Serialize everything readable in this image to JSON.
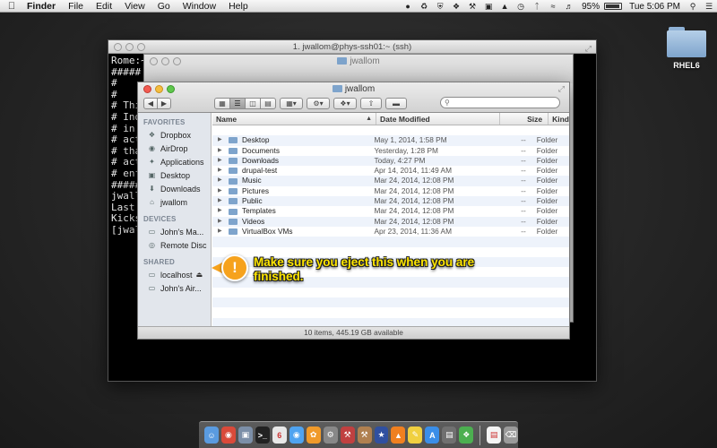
{
  "menubar": {
    "app": "Finder",
    "menus": [
      "File",
      "Edit",
      "View",
      "Go",
      "Window",
      "Help"
    ],
    "battery_percent": "95%",
    "battery_level": 0.95,
    "clock": "Tue 5:06 PM"
  },
  "desktop": {
    "icon_label": "RHEL6"
  },
  "terminal": {
    "title": "1. jwallom@phys-ssh01:~ (ssh)",
    "lines": [
      "Rome:~                                                                edu",
      "#####",
      "#",
      "#",
      "# This",
      "# Indi",
      "# in c",
      "# acti",
      "# that",
      "# acti",
      "# enfo",
      "######",
      "jwallo",
      "Last l",
      "Kickst",
      "[jwall"
    ]
  },
  "finder_back": {
    "title": "jwallom"
  },
  "finder": {
    "title": "jwallom",
    "search_placeholder": "",
    "sidebar": {
      "favorites_header": "FAVORITES",
      "favorites": [
        {
          "label": "Dropbox",
          "icon": "dropbox-icon"
        },
        {
          "label": "AirDrop",
          "icon": "airdrop-icon"
        },
        {
          "label": "Applications",
          "icon": "applications-icon"
        },
        {
          "label": "Desktop",
          "icon": "desktop-icon"
        },
        {
          "label": "Downloads",
          "icon": "downloads-icon"
        },
        {
          "label": "jwallom",
          "icon": "home-icon"
        }
      ],
      "devices_header": "DEVICES",
      "devices": [
        {
          "label": "John's Ma...",
          "icon": "laptop-icon"
        },
        {
          "label": "Remote Disc",
          "icon": "disc-icon"
        }
      ],
      "shared_header": "SHARED",
      "shared": [
        {
          "label": "localhost",
          "icon": "server-icon",
          "eject": true
        },
        {
          "label": "John's Air...",
          "icon": "laptop-icon"
        }
      ]
    },
    "columns": {
      "name": "Name",
      "date": "Date Modified",
      "size": "Size",
      "kind": "Kind"
    },
    "rows": [
      {
        "name": "Desktop",
        "date": "May 1, 2014, 1:58 PM",
        "size": "--",
        "kind": "Folder"
      },
      {
        "name": "Documents",
        "date": "Yesterday, 1:28 PM",
        "size": "--",
        "kind": "Folder"
      },
      {
        "name": "Downloads",
        "date": "Today, 4:27 PM",
        "size": "--",
        "kind": "Folder"
      },
      {
        "name": "drupal-test",
        "date": "Apr 14, 2014, 11:49 AM",
        "size": "--",
        "kind": "Folder"
      },
      {
        "name": "Music",
        "date": "Mar 24, 2014, 12:08 PM",
        "size": "--",
        "kind": "Folder"
      },
      {
        "name": "Pictures",
        "date": "Mar 24, 2014, 12:08 PM",
        "size": "--",
        "kind": "Folder"
      },
      {
        "name": "Public",
        "date": "Mar 24, 2014, 12:08 PM",
        "size": "--",
        "kind": "Folder"
      },
      {
        "name": "Templates",
        "date": "Mar 24, 2014, 12:08 PM",
        "size": "--",
        "kind": "Folder"
      },
      {
        "name": "Videos",
        "date": "Mar 24, 2014, 12:08 PM",
        "size": "--",
        "kind": "Folder"
      },
      {
        "name": "VirtualBox VMs",
        "date": "Apr 23, 2014, 11:36 AM",
        "size": "--",
        "kind": "Folder"
      }
    ],
    "status": "10 items, 445.19 GB available"
  },
  "callout": {
    "marker": "!",
    "text": "Make sure you eject this when you are finished.",
    "color": "#f6a21d",
    "text_color": "#ffe600"
  },
  "dock": {
    "items": [
      {
        "icon": "finder-icon",
        "color": "#5a9be0"
      },
      {
        "icon": "chrome-icon",
        "color": "#d94a3a"
      },
      {
        "icon": "preview-icon",
        "color": "#7c8fa8"
      },
      {
        "icon": "terminal-icon",
        "color": "#222222"
      },
      {
        "icon": "calendar-icon",
        "color": "#e8e8e8"
      },
      {
        "icon": "messages-icon",
        "color": "#4fa3f0"
      },
      {
        "icon": "growl-icon",
        "color": "#f09a2a"
      },
      {
        "icon": "system-preferences-icon",
        "color": "#888888"
      },
      {
        "icon": "utility-icon",
        "color": "#c04040"
      },
      {
        "icon": "tool-icon",
        "color": "#b08050"
      },
      {
        "icon": "app-icon",
        "color": "#3050a0"
      },
      {
        "icon": "vlc-icon",
        "color": "#f08020"
      },
      {
        "icon": "notes-icon",
        "color": "#f0d040"
      },
      {
        "icon": "app-store-icon",
        "color": "#3a8ee8"
      },
      {
        "icon": "activity-monitor-icon",
        "color": "#707070"
      },
      {
        "icon": "evernote-icon",
        "color": "#4caf50"
      }
    ],
    "tail": [
      {
        "icon": "document-icon",
        "color": "#f4f4f4"
      },
      {
        "icon": "trash-icon",
        "color": "#9a9a9a"
      }
    ]
  }
}
